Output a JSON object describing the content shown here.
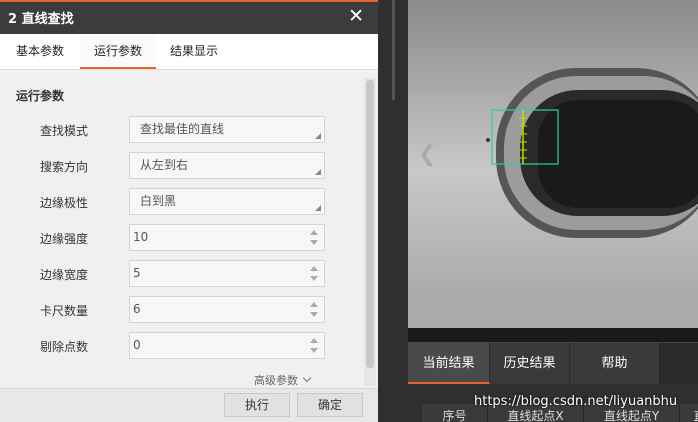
{
  "dialog": {
    "title": "2 直线查找",
    "close_glyph": "✕",
    "tabs": [
      "基本参数",
      "运行参数",
      "结果显示"
    ],
    "active_tab": "运行参数",
    "section_title": "运行参数",
    "params": [
      {
        "label": "查找模式",
        "value": "查找最佳的直线",
        "kind": "combo"
      },
      {
        "label": "搜索方向",
        "value": "从左到右",
        "kind": "combo"
      },
      {
        "label": "边缘极性",
        "value": "白到黑",
        "kind": "combo"
      },
      {
        "label": "边缘强度",
        "value": "10",
        "kind": "spin"
      },
      {
        "label": "边缘宽度",
        "value": "5",
        "kind": "spin"
      },
      {
        "label": "卡尺数量",
        "value": "6",
        "kind": "spin"
      },
      {
        "label": "剔除点数",
        "value": "0",
        "kind": "spin"
      }
    ],
    "advanced_label": "高级参数",
    "buttons": {
      "execute": "执行",
      "confirm": "确定"
    }
  },
  "result_panel": {
    "tabs": [
      "当前结果",
      "历史结果",
      "帮助"
    ],
    "active_tab": "当前结果",
    "columns": [
      "序号",
      "直线起点X",
      "直线起点Y",
      "直"
    ]
  },
  "watermark": "https://blog.csdn.net/liyuanbhu",
  "colors": {
    "accent": "#e8642c",
    "roi": "#2ad0a0",
    "caliper": "#b8e000"
  }
}
